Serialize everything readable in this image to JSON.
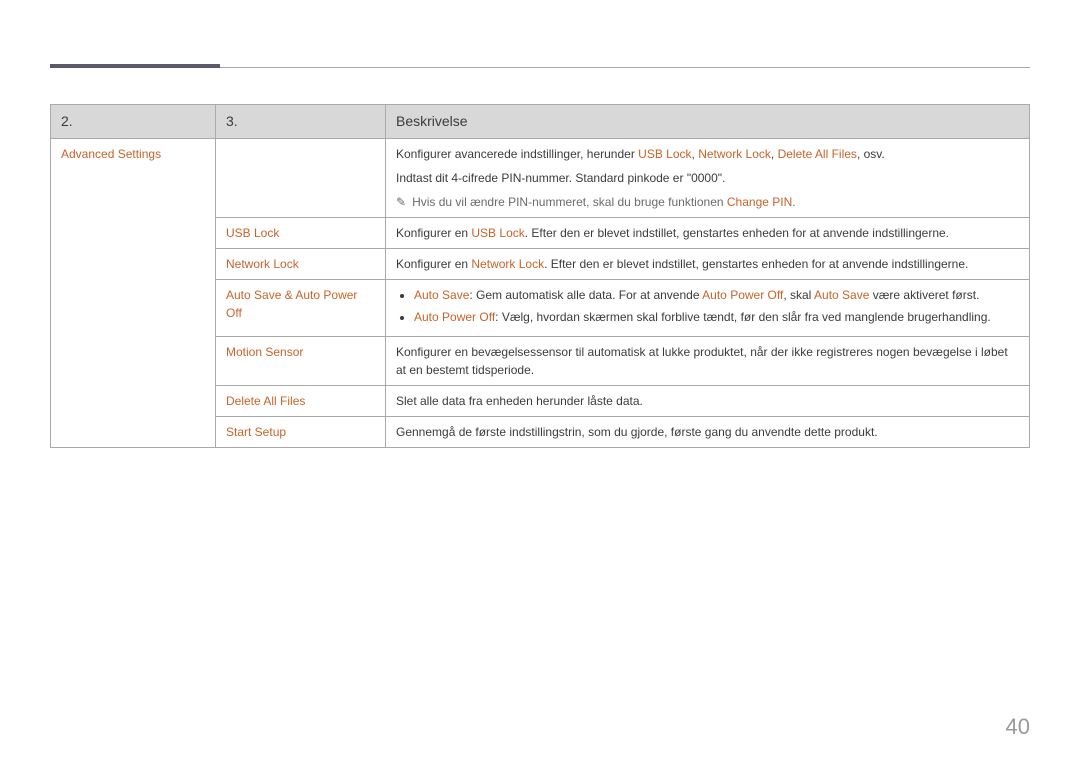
{
  "page_number": "40",
  "header": {
    "col1": "2.",
    "col2": "3.",
    "col3": "Beskrivelse"
  },
  "row1": {
    "c1": "Advanced Settings",
    "desc_prefix": "Konfigurer avancerede indstillinger, herunder ",
    "usb": "USB Lock",
    "net": "Network Lock",
    "del": "Delete All Files",
    "desc_suffix": ", osv.",
    "line2": "Indtast dit 4-cifrede PIN-nummer. Standard pinkode er \"0000\".",
    "note_prefix": "Hvis du vil ændre PIN-nummeret, skal du bruge funktionen ",
    "note_link": "Change PIN",
    "note_suffix": "."
  },
  "row2": {
    "c2": "USB Lock",
    "p1": "Konfigurer en ",
    "link": "USB Lock",
    "p2": ". Efter den er blevet indstillet, genstartes enheden for at anvende indstillingerne."
  },
  "row3": {
    "c2": "Network Lock",
    "p1": "Konfigurer en ",
    "link": "Network Lock",
    "p2": ". Efter den er blevet indstillet, genstartes enheden for at anvende indstillingerne."
  },
  "row4": {
    "c2": "Auto Save & Auto Power Off",
    "b1_a": "Auto Save",
    "b1_t1": ": Gem automatisk alle data. For at anvende ",
    "b1_b": "Auto Power Off",
    "b1_t2": ", skal ",
    "b1_c": "Auto Save",
    "b1_t3": " være aktiveret først.",
    "b2_a": "Auto Power Off",
    "b2_t": ": Vælg, hvordan skærmen skal forblive tændt, før den slår fra ved manglende brugerhandling."
  },
  "row5": {
    "c2": "Motion Sensor",
    "desc": "Konfigurer en bevægelsessensor til automatisk at lukke produktet, når der ikke registreres nogen bevægelse i løbet at en bestemt tidsperiode."
  },
  "row6": {
    "c2": "Delete All Files",
    "desc": "Slet alle data fra enheden herunder låste data."
  },
  "row7": {
    "c2": "Start Setup",
    "desc": "Gennemgå de første indstillingstrin, som du gjorde, første gang du anvendte dette produkt."
  }
}
